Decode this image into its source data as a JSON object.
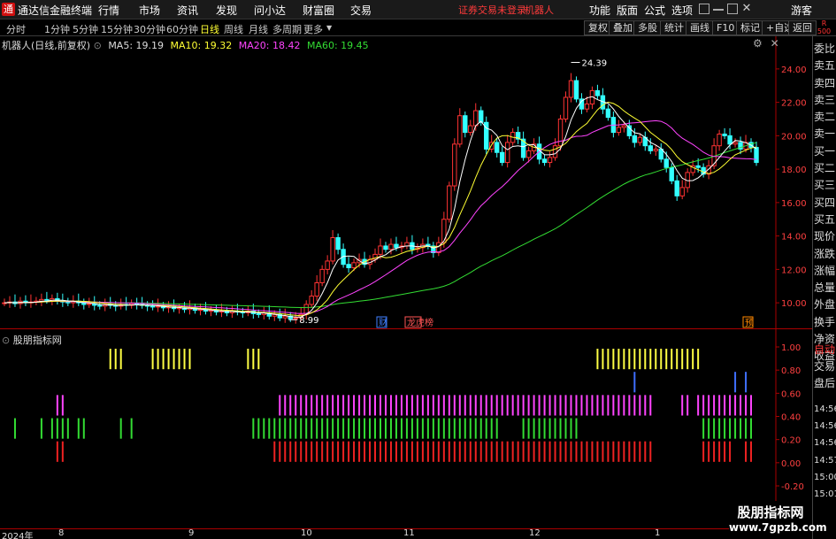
{
  "titlebar": {
    "logo_char": "通",
    "app_title": "通达信金融终端",
    "menus": [
      "行情",
      "市场",
      "资讯",
      "发现",
      "问小达",
      "财富圈",
      "交易"
    ],
    "login_status": "证券交易未登录",
    "login_user": "机器人",
    "right_menus": [
      "功能",
      "版面",
      "公式",
      "选项"
    ],
    "guest": "游客"
  },
  "toolbar": {
    "periods": [
      "分时",
      "1分钟",
      "5分钟",
      "15分钟",
      "30分钟",
      "60分钟",
      "日线",
      "周线",
      "月线",
      "多周期",
      "更多"
    ],
    "active_period": "日线",
    "buttons": [
      "复权",
      "叠加",
      "多股",
      "统计",
      "画线",
      "F10",
      "标记",
      "+自选",
      "返回"
    ],
    "side_tag_top": "R",
    "side_tag_bottom": "500"
  },
  "main_chart": {
    "stock_label": "机器人(日线,前复权)",
    "ma_legend": [
      {
        "label": "MA5: 19.19",
        "color": "#ffffff"
      },
      {
        "label": "MA10: 19.32",
        "color": "#ffff33"
      },
      {
        "label": "MA20: 18.42",
        "color": "#ff44ff"
      },
      {
        "label": "MA60: 19.45",
        "color": "#33dd33"
      }
    ],
    "high_annotation": "24.39",
    "low_annotation": "8.99",
    "markers": [
      {
        "text": "财",
        "color": "#3f7fff"
      },
      {
        "text": "龙虎榜",
        "color": "#ff5555"
      },
      {
        "text": "预",
        "color": "#ff8800"
      }
    ],
    "y_labels": [
      "24.00",
      "22.00",
      "20.00",
      "18.00",
      "16.00",
      "14.00",
      "12.00",
      "10.00"
    ]
  },
  "indicator": {
    "title": "股朋指标网",
    "y_labels": [
      "1.00",
      "0.80",
      "0.60",
      "0.40",
      "0.20",
      "0.00",
      "-0.20"
    ]
  },
  "right_panel": {
    "items": [
      "委比",
      "卖五",
      "卖四",
      "卖三",
      "卖二",
      "卖一",
      "买一",
      "买二",
      "买三",
      "买四",
      "买五",
      "现价",
      "涨跌",
      "涨幅",
      "总量",
      "外盘",
      "换手",
      "净资",
      "收益",
      "自动",
      "交易",
      "盘后",
      "14:56",
      "14:56",
      "14:56",
      "14:57",
      "15:00",
      "15:01"
    ]
  },
  "date_axis": {
    "labels": [
      "2024年",
      "8",
      "9",
      "10",
      "11",
      "12",
      "1"
    ]
  },
  "watermark": {
    "title": "股朋指标网",
    "url": "www.7gpzb.com"
  },
  "chart_data": [
    {
      "type": "candlestick",
      "title": "机器人(日线,前复权)",
      "ylim": [
        9,
        25
      ],
      "grid": false,
      "close": [
        10.0,
        10.05,
        9.95,
        10.1,
        10.0,
        10.05,
        10.1,
        10.2,
        10.15,
        10.25,
        10.1,
        10.05,
        10.0,
        10.1,
        10.0,
        9.9,
        9.95,
        9.85,
        9.8,
        9.9,
        9.85,
        9.8,
        9.9,
        9.85,
        9.95,
        9.9,
        9.85,
        9.8,
        9.75,
        9.8,
        9.7,
        9.75,
        9.65,
        9.7,
        9.6,
        9.7,
        9.55,
        9.6,
        9.5,
        9.55,
        9.45,
        9.5,
        9.4,
        9.5,
        9.45,
        9.4,
        9.5,
        9.35,
        9.3,
        9.4,
        9.2,
        9.3,
        9.1,
        9.2,
        9.05,
        9.1,
        9.3,
        9.9,
        10.4,
        11.2,
        12.0,
        12.5,
        13.9,
        13.2,
        12.3,
        12.1,
        12.4,
        12.6,
        12.3,
        12.6,
        12.9,
        13.4,
        13.2,
        13.5,
        13.3,
        13.4,
        13.6,
        13.2,
        13.3,
        13.5,
        13.4,
        13.0,
        13.6,
        15.0,
        17.0,
        19.5,
        21.2,
        20.2,
        20.6,
        21.5,
        20.8,
        19.2,
        19.6,
        19.0,
        18.4,
        19.6,
        20.2,
        19.8,
        18.7,
        19.1,
        19.5,
        18.6,
        18.4,
        18.7,
        19.4,
        21.0,
        22.3,
        23.3,
        22.2,
        21.6,
        21.9,
        22.7,
        22.4,
        21.6,
        21.1,
        20.2,
        20.5,
        20.6,
        20.0,
        19.6,
        19.9,
        19.4,
        19.1,
        19.2,
        18.6,
        18.1,
        17.3,
        16.4,
        16.9,
        17.8,
        18.2,
        18.1,
        17.7,
        18.2,
        19.4,
        20.1,
        20.0,
        19.5,
        19.6,
        19.2,
        19.6,
        19.3,
        18.4
      ],
      "ma": [
        {
          "name": "MA5",
          "last": 19.19
        },
        {
          "name": "MA10",
          "last": 19.32
        },
        {
          "name": "MA20",
          "last": 18.42
        },
        {
          "name": "MA60",
          "last": 19.45
        }
      ],
      "high": 24.39,
      "low": 8.99
    },
    {
      "type": "bar",
      "title": "股朋指标网",
      "ylim": [
        -0.2,
        1.0
      ],
      "series": [
        {
          "color": "#ffff44",
          "values": [
            1.0,
            0.8
          ]
        },
        {
          "color": "#3f6fff",
          "values": [
            0.8,
            0.6
          ]
        },
        {
          "color": "#ff44ff",
          "values": [
            0.6,
            0.4
          ]
        },
        {
          "color": "#33dd33",
          "values": [
            0.4,
            0.2
          ]
        },
        {
          "color": "#ee2222",
          "values": [
            0.2,
            0.0
          ]
        }
      ],
      "active": {
        "yellow": [
          [
            20,
            22
          ],
          [
            28,
            35
          ],
          [
            46,
            48
          ],
          [
            112,
            131
          ]
        ],
        "blue": [
          [
            119,
            119
          ],
          [
            138,
            138
          ],
          [
            140,
            140
          ]
        ],
        "pink": [
          [
            10,
            11
          ],
          [
            52,
            122
          ],
          [
            128,
            129
          ],
          [
            131,
            141
          ]
        ],
        "green": [
          [
            2,
            2
          ],
          [
            7,
            7
          ],
          [
            9,
            12
          ],
          [
            14,
            15
          ],
          [
            22,
            22
          ],
          [
            24,
            24
          ],
          [
            47,
            76
          ],
          [
            77,
            93
          ],
          [
            98,
            108
          ],
          [
            132,
            141
          ]
        ],
        "red": [
          [
            10,
            11
          ],
          [
            51,
            122
          ],
          [
            132,
            137
          ],
          [
            140,
            141
          ]
        ]
      }
    }
  ]
}
